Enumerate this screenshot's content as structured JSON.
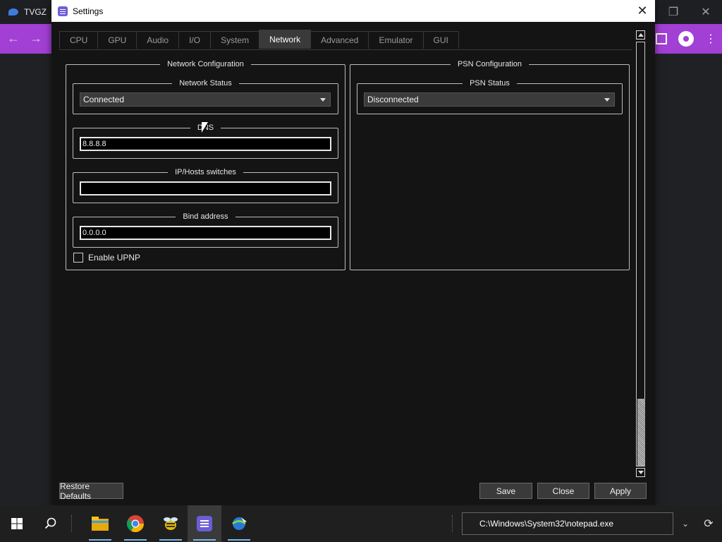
{
  "background_browser": {
    "tab_title": "TVGZ"
  },
  "window": {
    "title": "Settings"
  },
  "tabs": [
    {
      "label": "CPU"
    },
    {
      "label": "GPU"
    },
    {
      "label": "Audio"
    },
    {
      "label": "I/O"
    },
    {
      "label": "System"
    },
    {
      "label": "Network",
      "active": true
    },
    {
      "label": "Advanced"
    },
    {
      "label": "Emulator"
    },
    {
      "label": "GUI"
    }
  ],
  "network_configuration": {
    "title": "Network Configuration",
    "network_status": {
      "label": "Network Status",
      "value": "Connected"
    },
    "dns": {
      "label": "DNS",
      "value": "8.8.8.8"
    },
    "ip_hosts": {
      "label": "IP/Hosts switches",
      "value": ""
    },
    "bind_address": {
      "label": "Bind address",
      "value": "0.0.0.0"
    },
    "upnp": {
      "label": "Enable UPNP",
      "checked": false
    }
  },
  "psn_configuration": {
    "title": "PSN Configuration",
    "psn_status": {
      "label": "PSN Status",
      "value": "Disconnected"
    }
  },
  "buttons": {
    "restore_defaults": "Restore Defaults",
    "save": "Save",
    "close": "Close",
    "apply": "Apply"
  },
  "taskbar": {
    "search_value": "C:\\Windows\\System32\\notepad.exe",
    "icons": [
      "windows-start-icon",
      "search-icon",
      "file-explorer-icon",
      "chrome-icon",
      "bee-app-icon",
      "rpcs3-icon",
      "network-app-icon"
    ]
  },
  "colors": {
    "browser_toolbar": "#a23fd4",
    "window_bg": "#141414",
    "button_bg": "#3a3a3a"
  }
}
